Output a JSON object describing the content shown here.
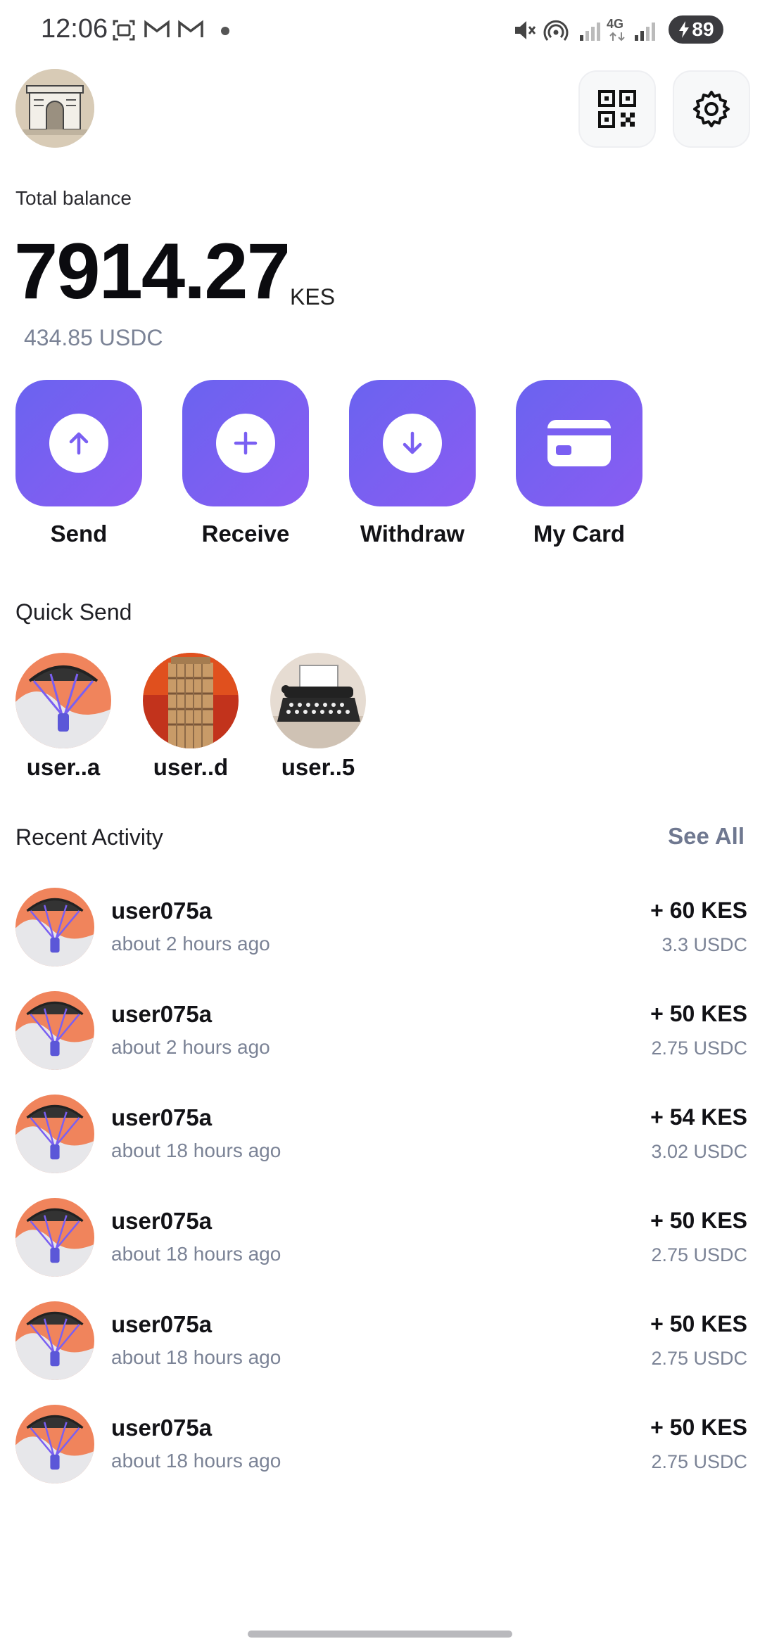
{
  "status_bar": {
    "time": "12:06",
    "network": "4G",
    "battery": "89",
    "icons": [
      "screenshot-icon",
      "gmail-icon",
      "gmail-icon",
      "dot-icon",
      "mute-icon",
      "hotspot-icon",
      "signal-icon",
      "signal-icon",
      "battery-charging-icon"
    ]
  },
  "header": {
    "avatar_icon": "profile-avatar",
    "qr_icon": "qr-code-icon",
    "settings_icon": "gear-icon"
  },
  "balance": {
    "label": "Total balance",
    "amount": "7914.27",
    "currency": "KES",
    "usdc": "434.85 USDC"
  },
  "actions": [
    {
      "label": "Send",
      "icon": "arrow-up-icon"
    },
    {
      "label": "Receive",
      "icon": "plus-icon"
    },
    {
      "label": "Withdraw",
      "icon": "arrow-down-icon"
    },
    {
      "label": "My Card",
      "icon": "card-icon"
    }
  ],
  "quick_send": {
    "title": "Quick Send",
    "contacts": [
      {
        "label": "user..a",
        "avatar": "parachute-avatar"
      },
      {
        "label": "user..d",
        "avatar": "tower-avatar"
      },
      {
        "label": "user..5",
        "avatar": "typewriter-avatar"
      }
    ]
  },
  "recent_activity": {
    "title": "Recent Activity",
    "see_all": "See All",
    "items": [
      {
        "name": "user075a",
        "time": "about 2 hours ago",
        "amount": "+ 60 KES",
        "usdc": "3.3 USDC"
      },
      {
        "name": "user075a",
        "time": "about 2 hours ago",
        "amount": "+ 50 KES",
        "usdc": "2.75 USDC"
      },
      {
        "name": "user075a",
        "time": "about 18 hours ago",
        "amount": "+ 54 KES",
        "usdc": "3.02 USDC"
      },
      {
        "name": "user075a",
        "time": "about 18 hours ago",
        "amount": "+ 50 KES",
        "usdc": "2.75 USDC"
      },
      {
        "name": "user075a",
        "time": "about 18 hours ago",
        "amount": "+ 50 KES",
        "usdc": "2.75 USDC"
      },
      {
        "name": "user075a",
        "time": "about 18 hours ago",
        "amount": "+ 50 KES",
        "usdc": "2.75 USDC"
      }
    ]
  },
  "colors": {
    "accent_start": "#6a63f0",
    "accent_end": "#8a5cf2",
    "muted_text": "#7b8396"
  }
}
